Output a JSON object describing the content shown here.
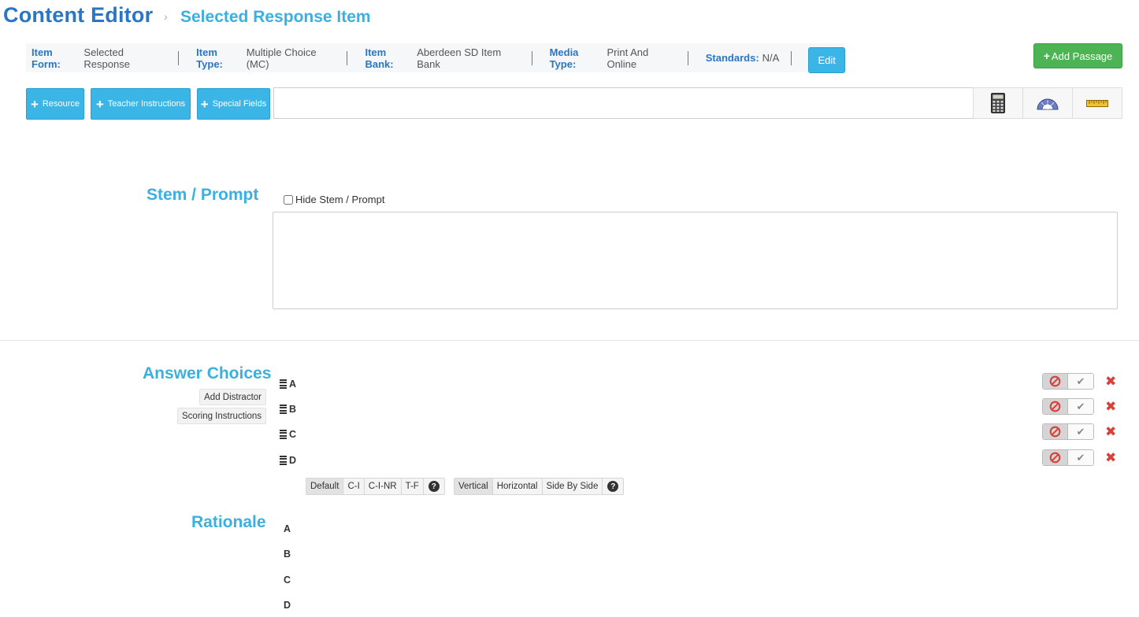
{
  "header": {
    "title": "Content Editor",
    "separator": "›",
    "breadcrumb": "Selected Response Item"
  },
  "info_bar": {
    "items": [
      {
        "key": "Item Form:",
        "value": "Selected Response"
      },
      {
        "key": "Item Type:",
        "value": "Multiple Choice (MC)"
      },
      {
        "key": "Item Bank:",
        "value": "Aberdeen SD Item Bank"
      },
      {
        "key": "Media Type:",
        "value": "Print And Online"
      },
      {
        "key": "Standards:",
        "value": "N/A"
      }
    ],
    "edit_label": "Edit"
  },
  "add_passage_label": "Add Passage",
  "toolbar": {
    "resource_label": "Resource",
    "teacher_instructions_label": "Teacher Instructions",
    "special_fields_label": "Special Fields",
    "tools": [
      "calculator-icon",
      "protractor-icon",
      "ruler-icon"
    ]
  },
  "stem": {
    "heading": "Stem / Prompt",
    "hide_label": "Hide Stem / Prompt",
    "hide_checked": false
  },
  "answers": {
    "heading": "Answer Choices",
    "add_distractor_label": "Add Distractor",
    "scoring_instructions_label": "Scoring Instructions",
    "choices": [
      "A",
      "B",
      "C",
      "D"
    ],
    "scoring_options": [
      "Default",
      "C-I",
      "C-I-NR",
      "T-F"
    ],
    "scoring_selected": "Default",
    "layout_options": [
      "Vertical",
      "Horizontal",
      "Side By Side"
    ],
    "layout_selected": "Vertical",
    "help": "?"
  },
  "rationale": {
    "heading": "Rationale",
    "letters": [
      "A",
      "B",
      "C",
      "D"
    ]
  },
  "colors": {
    "title": "#2a76c4",
    "accent": "#3bb0e0",
    "button": "#3bb5e6",
    "success": "#4cb452",
    "danger": "#d9403a"
  }
}
